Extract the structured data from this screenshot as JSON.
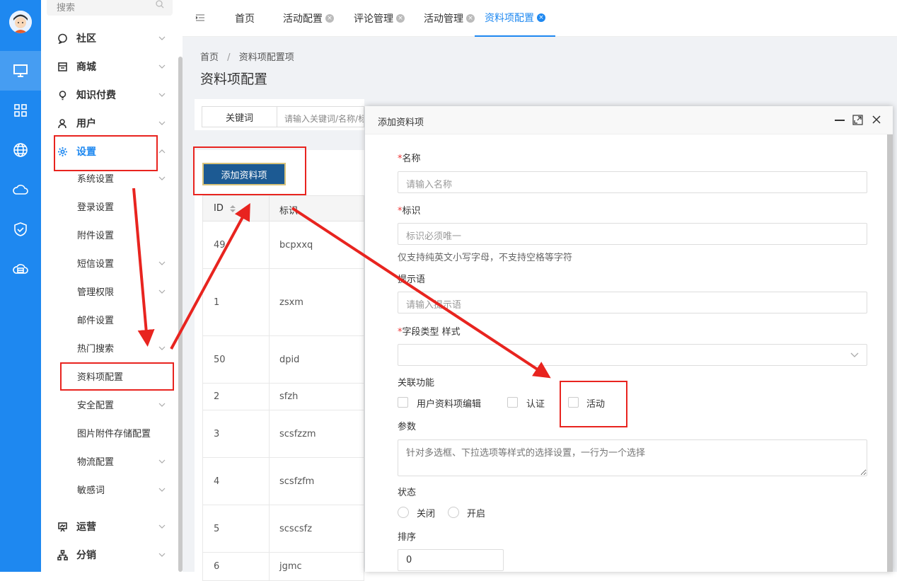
{
  "menu": {
    "search_placeholder": "搜索",
    "items": [
      {
        "label": "社区",
        "type": "top",
        "icon": "chat-icon"
      },
      {
        "label": "商城",
        "type": "top",
        "icon": "store-icon"
      },
      {
        "label": "知识付费",
        "type": "top",
        "icon": "bulb-icon"
      },
      {
        "label": "用户",
        "type": "top",
        "icon": "user-icon"
      },
      {
        "label": "设置",
        "type": "top",
        "icon": "gear-icon",
        "active": true
      },
      {
        "label": "系统设置",
        "type": "sub"
      },
      {
        "label": "登录设置",
        "type": "sub"
      },
      {
        "label": "附件设置",
        "type": "sub"
      },
      {
        "label": "短信设置",
        "type": "sub"
      },
      {
        "label": "管理权限",
        "type": "sub"
      },
      {
        "label": "邮件设置",
        "type": "sub"
      },
      {
        "label": "热门搜索",
        "type": "sub"
      },
      {
        "label": "资料项配置",
        "type": "sub"
      },
      {
        "label": "安全配置",
        "type": "sub"
      },
      {
        "label": "图片附件存储配置",
        "type": "sub"
      },
      {
        "label": "物流配置",
        "type": "sub"
      },
      {
        "label": "敏感词",
        "type": "sub"
      },
      {
        "label": "运营",
        "type": "top",
        "icon": "presentation-icon"
      },
      {
        "label": "分销",
        "type": "top",
        "icon": "hierarchy-icon"
      }
    ]
  },
  "tabs": [
    {
      "label": "首页",
      "closable": false
    },
    {
      "label": "活动配置",
      "closable": true
    },
    {
      "label": "评论管理",
      "closable": true
    },
    {
      "label": "活动管理",
      "closable": true
    },
    {
      "label": "资料项配置",
      "closable": true,
      "active": true
    }
  ],
  "breadcrumb": {
    "home": "首页",
    "sep": "/",
    "current": "资料项配置项"
  },
  "page_title": "资料项配置",
  "filter": {
    "keyword_label": "关键词",
    "keyword_placeholder": "请输入关键词/名称/标识"
  },
  "add_button": "添加资料项",
  "table": {
    "headers": [
      "ID",
      "标识"
    ],
    "rows": [
      {
        "id": "49",
        "key": "bcpxxq"
      },
      {
        "id": "1",
        "key": "zsxm"
      },
      {
        "id": "50",
        "key": "dpid"
      },
      {
        "id": "2",
        "key": "sfzh"
      },
      {
        "id": "3",
        "key": "scsfzzm"
      },
      {
        "id": "4",
        "key": "scsfzfm"
      },
      {
        "id": "5",
        "key": "scscsfz"
      },
      {
        "id": "6",
        "key": "jgmc"
      }
    ]
  },
  "modal": {
    "title": "添加资料项",
    "name_label": "名称",
    "name_placeholder": "请输入名称",
    "key_label": "标识",
    "key_placeholder": "标识必须唯一",
    "key_hint": "仅支持纯英文小写字母，不支持空格等字符",
    "tip_label": "提示语",
    "tip_placeholder": "请输入提示语",
    "type_label": "字段类型 样式",
    "type_value": "",
    "assoc_label": "关联功能",
    "assoc_options": [
      "用户资料项编辑",
      "认证",
      "活动"
    ],
    "param_label": "参数",
    "param_placeholder": "针对多选框、下拉选项等样式的选择设置，一行为一个选择",
    "status_label": "状态",
    "status_options": [
      "关闭",
      "开启"
    ],
    "sort_label": "排序",
    "sort_value": "0",
    "required_mark": "*"
  },
  "colors": {
    "accent": "#1e88f0",
    "annotation": "#e8241f",
    "add_button": "#1c5a93"
  }
}
